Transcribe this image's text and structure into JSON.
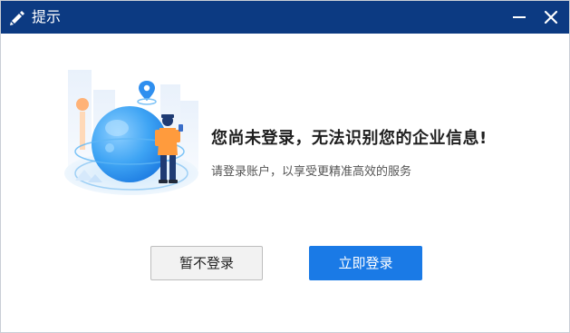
{
  "window": {
    "title": "提示",
    "title_icon": "edit-icon",
    "minimize_icon": "minimize-icon",
    "close_icon": "close-icon"
  },
  "dialog": {
    "headline": "您尚未登录，无法识别您的企业信息!",
    "subtext": "请登录账户，以享受更精准高效的服务",
    "illustration": "globe-person-location-illustration"
  },
  "buttons": {
    "skip_label": "暂不登录",
    "login_label": "立即登录"
  },
  "colors": {
    "titlebar": "#0c3a82",
    "primary": "#1a7ae6",
    "secondary_bg": "#f2f2f2"
  }
}
